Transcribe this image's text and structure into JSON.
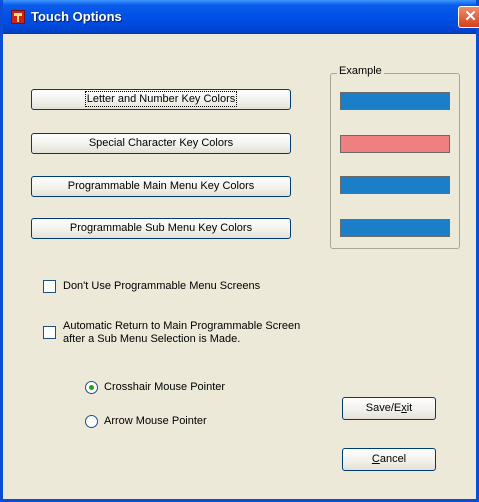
{
  "window": {
    "title": "Touch Options",
    "close_glyph": "✕"
  },
  "color_buttons": [
    {
      "label": "Letter and Number Key Colors",
      "swatch_color": "#1a7fc8"
    },
    {
      "label": "Special Character Key Colors",
      "swatch_color": "#f08080"
    },
    {
      "label": "Programmable Main Menu Key Colors",
      "swatch_color": "#1a7fc8"
    },
    {
      "label": "Programmable Sub Menu Key Colors",
      "swatch_color": "#1a7fc8"
    }
  ],
  "example_group": {
    "legend": "Example"
  },
  "options": {
    "dont_use_programmable": {
      "label": "Don't Use Programmable Menu Screens",
      "checked": false
    },
    "auto_return": {
      "label": "Automatic Return to Main Programmable Screen after a Sub Menu Selection is Made.",
      "checked": false
    }
  },
  "pointer": {
    "crosshair_label": "Crosshair Mouse Pointer",
    "arrow_label": "Arrow Mouse Pointer",
    "selected": "Crosshair Mouse Pointer"
  },
  "actions": {
    "save_prefix": "Save/E",
    "save_underlined": "x",
    "save_suffix": "it",
    "cancel_underlined": "C",
    "cancel_suffix": "ancel"
  },
  "colors": {
    "title_bar": "#0050e8",
    "dialog_bg": "#ece9d8",
    "key_blue": "#1a7fc8",
    "key_pink": "#f08080"
  }
}
